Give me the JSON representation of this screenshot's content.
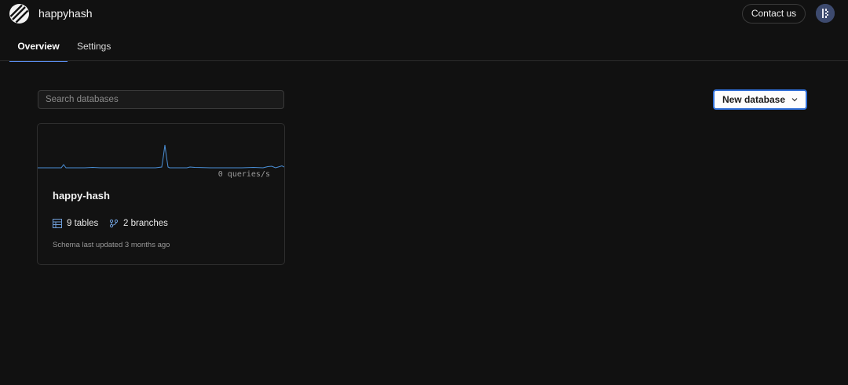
{
  "header": {
    "org_name": "happyhash",
    "contact_label": "Contact us",
    "logo_icon": "planetscale-logo-icon",
    "avatar_icon": "user-avatar-icon"
  },
  "tabs": [
    {
      "label": "Overview",
      "active": true
    },
    {
      "label": "Settings",
      "active": false
    }
  ],
  "search": {
    "placeholder": "Search databases",
    "value": ""
  },
  "new_database": {
    "label": "New database",
    "icon": "chevron-down-icon"
  },
  "databases": [
    {
      "name": "happy-hash",
      "qps_text": "0 queries/s",
      "tables_text": "9 tables",
      "branches_text": "2 branches",
      "updated_text": "Schema last updated 3 months ago",
      "tables_icon": "table-icon",
      "branches_icon": "branch-icon"
    }
  ],
  "colors": {
    "background": "#111111",
    "accent": "#2f6fd8",
    "sparkline": "#4a8fd6",
    "tab_indicator": "#5b8def"
  }
}
